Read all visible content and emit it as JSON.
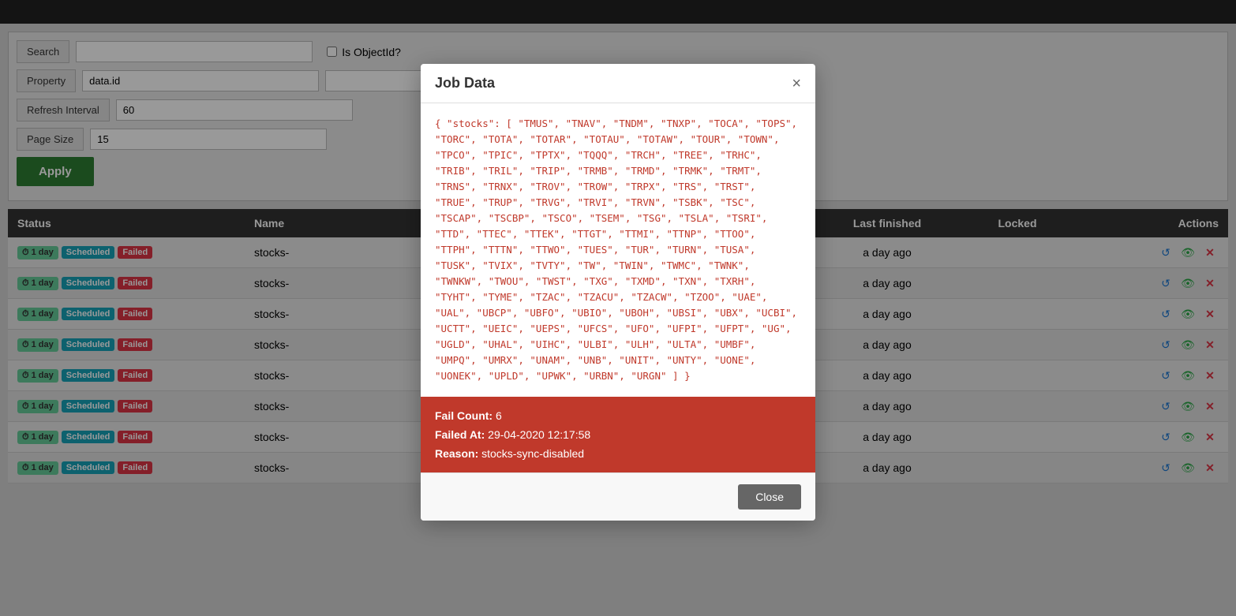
{
  "topbar": {},
  "filters": {
    "search_label": "Search",
    "property_label": "Property",
    "property_value": "data.id",
    "refresh_label": "Refresh Interval",
    "refresh_value": "60",
    "pagesize_label": "Page Size",
    "pagesize_value": "15",
    "objectid_label": "Is ObjectId?",
    "apply_label": "Apply"
  },
  "table": {
    "headers": {
      "status": "Status",
      "name": "Name",
      "last_finished": "Last finished",
      "locked": "Locked",
      "actions": "Actions"
    },
    "rows": [
      {
        "interval": "1 day",
        "scheduled": "Scheduled",
        "failed": "Failed",
        "name": "stocks-",
        "last_finished": "a day ago",
        "locked": ""
      },
      {
        "interval": "1 day",
        "scheduled": "Scheduled",
        "failed": "Failed",
        "name": "stocks-",
        "last_finished": "a day ago",
        "locked": ""
      },
      {
        "interval": "1 day",
        "scheduled": "Scheduled",
        "failed": "Failed",
        "name": "stocks-",
        "last_finished": "a day ago",
        "locked": ""
      },
      {
        "interval": "1 day",
        "scheduled": "Scheduled",
        "failed": "Failed",
        "name": "stocks-",
        "last_finished": "a day ago",
        "locked": ""
      },
      {
        "interval": "1 day",
        "scheduled": "Scheduled",
        "failed": "Failed",
        "name": "stocks-",
        "last_finished": "a day ago",
        "locked": ""
      },
      {
        "interval": "1 day",
        "scheduled": "Scheduled",
        "failed": "Failed",
        "name": "stocks-",
        "last_finished": "a day ago",
        "locked": ""
      },
      {
        "interval": "1 day",
        "scheduled": "Scheduled",
        "failed": "Failed",
        "name": "stocks-",
        "last_finished": "a day ago",
        "locked": ""
      },
      {
        "interval": "1 day",
        "scheduled": "Scheduled",
        "failed": "Failed",
        "name": "stocks-",
        "last_finished": "a day ago",
        "locked": ""
      }
    ]
  },
  "modal": {
    "title": "Job Data",
    "close_x": "×",
    "job_data_text": "{ \"stocks\": [ \"TMUS\", \"TNAV\", \"TNDM\", \"TNXP\", \"TOCA\", \"TOPS\", \"TORC\", \"TOTA\", \"TOTAR\", \"TOTAU\", \"TOTAW\", \"TOUR\", \"TOWN\", \"TPCO\", \"TPIC\", \"TPTX\", \"TQQQ\", \"TRCH\", \"TREE\", \"TRHC\", \"TRIB\", \"TRIL\", \"TRIP\", \"TRMB\", \"TRMD\", \"TRMK\", \"TRMT\", \"TRNS\", \"TRNX\", \"TROV\", \"TROW\", \"TRPX\", \"TRS\", \"TRST\", \"TRUE\", \"TRUP\", \"TRVG\", \"TRVI\", \"TRVN\", \"TSBK\", \"TSC\", \"TSCAP\", \"TSCBP\", \"TSCO\", \"TSEM\", \"TSG\", \"TSLA\", \"TSRI\", \"TTD\", \"TTEC\", \"TTEK\", \"TTGT\", \"TTMI\", \"TTNP\", \"TTOO\", \"TTPH\", \"TTTN\", \"TTWO\", \"TUES\", \"TUR\", \"TURN\", \"TUSA\", \"TUSK\", \"TVIX\", \"TVTY\", \"TW\", \"TWIN\", \"TWMC\", \"TWNK\", \"TWNKW\", \"TWOU\", \"TWST\", \"TXG\", \"TXMD\", \"TXN\", \"TXRH\", \"TYHT\", \"TYME\", \"TZAC\", \"TZACU\", \"TZACW\", \"TZOO\", \"UAE\", \"UAL\", \"UBCP\", \"UBFO\", \"UBIO\", \"UBOH\", \"UBSI\", \"UBX\", \"UCBI\", \"UCTT\", \"UEIC\", \"UEPS\", \"UFCS\", \"UFO\", \"UFPI\", \"UFPT\", \"UG\", \"UGLD\", \"UHAL\", \"UIHC\", \"ULBI\", \"ULH\", \"ULTA\", \"UMBF\", \"UMPQ\", \"UMRX\", \"UNAM\", \"UNB\", \"UNIT\", \"UNTY\", \"UONE\", \"UONEK\", \"UPLD\", \"UPWK\", \"URBN\", \"URGN\" ] }",
    "fail_count_label": "Fail Count:",
    "fail_count_value": "6",
    "failed_at_label": "Failed At:",
    "failed_at_value": "29-04-2020 12:17:58",
    "reason_label": "Reason:",
    "reason_value": "stocks-sync-disabled",
    "close_btn_label": "Close"
  }
}
